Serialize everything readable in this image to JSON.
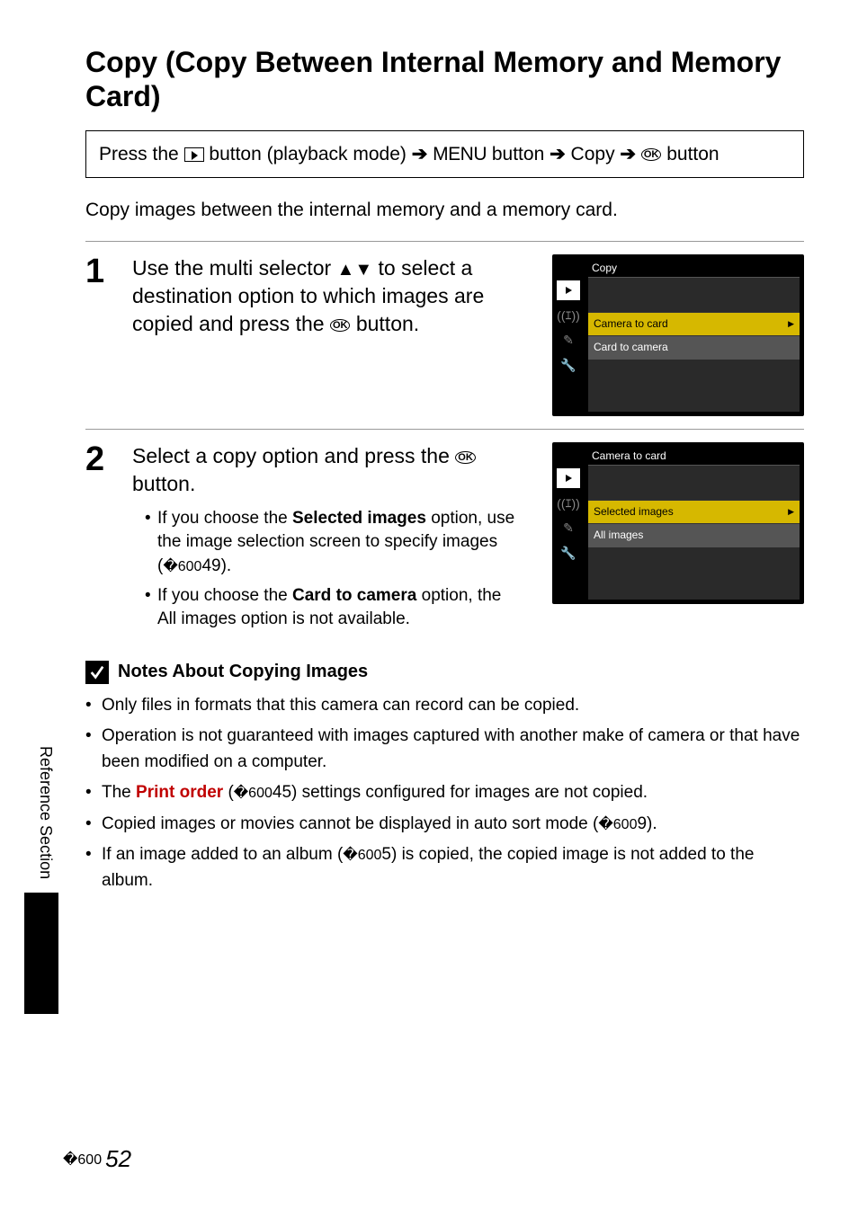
{
  "title": "Copy (Copy Between Internal Memory and Memory Card)",
  "path": {
    "press_the": "Press the",
    "playback_mode": "button (playback mode)",
    "menu": "MENU",
    "button_word": "button",
    "copy": "Copy"
  },
  "intro": "Copy images between the internal memory and a memory card.",
  "step1": {
    "num": "1",
    "text_a": "Use the multi selector",
    "text_b": "to select a destination option to which images are copied and press the",
    "text_c": "button."
  },
  "step2": {
    "num": "2",
    "text_a": "Select a copy option and press the",
    "text_b": "button.",
    "bullet1_a": "If you choose the",
    "bullet1_bold": "Selected images",
    "bullet1_b": "option, use the image selection screen to specify images (",
    "bullet1_c": "49).",
    "bullet2_a": "If you choose the",
    "bullet2_bold": "Card to camera",
    "bullet2_b": "option, the All images option is not available."
  },
  "screen1": {
    "title": "Copy",
    "item1": "Camera to card",
    "item2": "Card to camera"
  },
  "screen2": {
    "title": "Camera to card",
    "item1": "Selected images",
    "item2": "All images"
  },
  "notes": {
    "heading": "Notes About Copying Images",
    "n1": "Only files in formats that this camera can record can be copied.",
    "n2": "Operation is not guaranteed with images captured with another make of camera or that have been modified on a computer.",
    "n3_a": "The",
    "n3_bold": "Print order",
    "n3_b": "(",
    "n3_c": "45) settings configured for images are not copied.",
    "n4_a": "Copied images or movies cannot be displayed in auto sort mode (",
    "n4_b": "9).",
    "n5_a": "If an image added to an album (",
    "n5_b": "5) is copied, the copied image is not added to the album."
  },
  "side": "Reference Section",
  "page_num": "52"
}
